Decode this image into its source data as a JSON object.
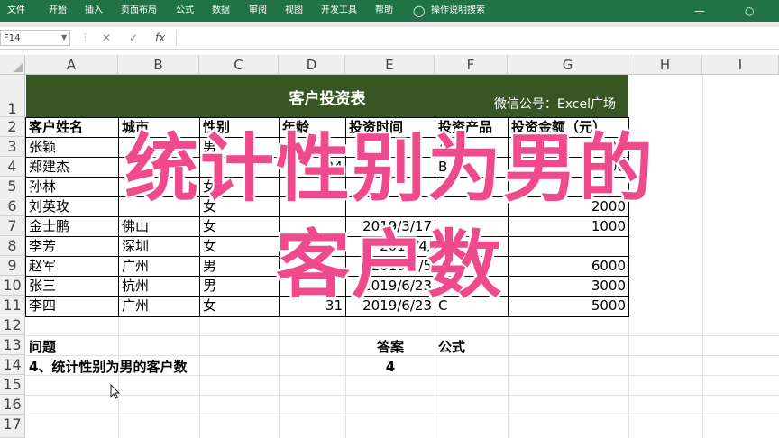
{
  "ribbon": {
    "tabs": [
      "文件",
      "开始",
      "插入",
      "页面布局",
      "公式",
      "数据",
      "审阅",
      "视图",
      "开发工具",
      "帮助"
    ],
    "tell_me": "操作说明搜索",
    "bulb_icon": "lightbulb-icon"
  },
  "formula_bar": {
    "name_box": "F14",
    "cancel": "✕",
    "enter": "✓",
    "fx": "fx",
    "formula": ""
  },
  "columns": [
    "A",
    "B",
    "C",
    "D",
    "E",
    "F",
    "G",
    "H",
    "I"
  ],
  "rows": [
    "1",
    "2",
    "3",
    "4",
    "5",
    "6",
    "7",
    "8",
    "9",
    "10",
    "11",
    "12",
    "13",
    "14",
    "15",
    "16",
    "17"
  ],
  "sheet": {
    "title": "客户投资表",
    "watermark": "微信公号：Excel广场",
    "headers": [
      "客户姓名",
      "城市",
      "性别",
      "年龄",
      "投资时间",
      "投资产品",
      "投资金额（元）"
    ],
    "data_rows": [
      [
        "张颖",
        "",
        "男",
        "",
        "",
        "A",
        "4000"
      ],
      [
        "郑建杰",
        "",
        "",
        "24",
        "",
        "B",
        "2000"
      ],
      [
        "孙林",
        "",
        "女",
        "",
        "",
        "C",
        ""
      ],
      [
        "刘英玫",
        "",
        "女",
        "",
        "",
        "",
        "2000"
      ],
      [
        "金士鹏",
        "佛山",
        "女",
        "",
        "2019/3/17",
        "",
        "1000"
      ],
      [
        "李芳",
        "深圳",
        "女",
        "",
        "2019/4/",
        "",
        ""
      ],
      [
        "赵军",
        "广州",
        "男",
        "",
        "2019/5/5",
        "",
        "6000"
      ],
      [
        "张三",
        "杭州",
        "男",
        "",
        "2019/6/23",
        "",
        "3000"
      ],
      [
        "李四",
        "广州",
        "女",
        "31",
        "2019/6/23",
        "C",
        "5000"
      ]
    ],
    "question_label": "问题",
    "answer_label": "答案",
    "formula_label": "公式",
    "question": "4、统计性别为男的客户数",
    "answer": "4"
  },
  "overlay": {
    "line1": "统计性别为男的",
    "line2": "客户数",
    "color": "#ee4a8c"
  },
  "colors": {
    "ribbon": "#217346",
    "title_fill": "#375623"
  }
}
